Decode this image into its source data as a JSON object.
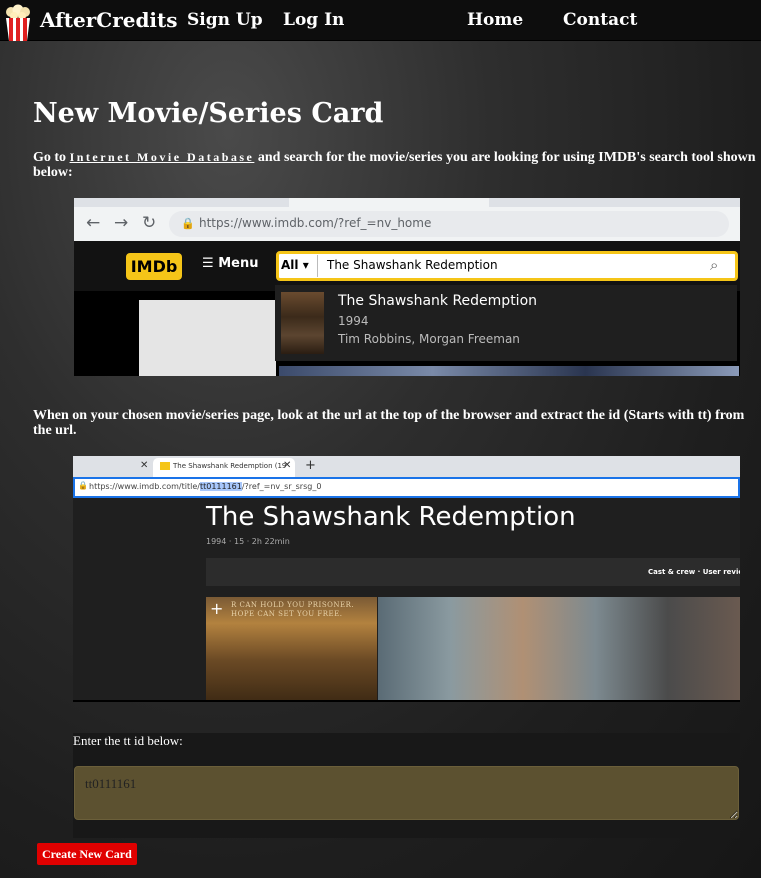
{
  "nav": {
    "brand": "AfterCredits",
    "sign_up": "Sign Up",
    "log_in": "Log In",
    "home": "Home",
    "contact": "Contact",
    "logo_icon": "popcorn-icon"
  },
  "main": {
    "title": "New Movie/Series Card",
    "instruction1_prefix": "Go to",
    "instruction1_link": "Internet Movie Database",
    "instruction1_suffix": "and search for the movie/series you are looking for using IMDB's search tool shown below:",
    "instruction2": "When on your chosen movie/series page, look at the url at the top of the browser and extract the id (Starts with tt) from the url."
  },
  "screenshot1": {
    "url": "https://www.imdb.com/?ref_=nv_home",
    "logo": "IMDb",
    "menu": "Menu",
    "search_category": "All",
    "search_query": "The Shawshank Redemption",
    "result_title": "The Shawshank Redemption",
    "result_year": "1994",
    "result_cast": "Tim Robbins, Morgan Freeman"
  },
  "screenshot2": {
    "tab_title": "The Shawshank Redemption (19",
    "url_prefix": "https://www.imdb.com/title/",
    "url_id": "tt0111161",
    "url_suffix": "/?ref_=nv_sr_srsg_0",
    "page_title": "The Shawshank Redemption",
    "meta": "1994 · 15 · 2h 22min",
    "nav_links": "Cast & crew · User revie",
    "poster_tagline_1": "R CAN HOLD YOU PRISONER.",
    "poster_tagline_2": "HOPE CAN SET YOU FREE."
  },
  "form": {
    "label": "Enter the tt id below:",
    "placeholder": "tt0111161",
    "submit": "Create New Card"
  },
  "colors": {
    "accent_red": "#e00000",
    "imdb_yellow": "#f5c518",
    "input_bg": "#5c5130"
  }
}
